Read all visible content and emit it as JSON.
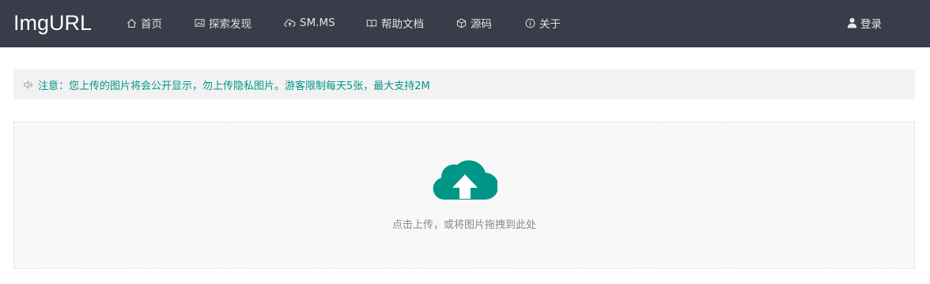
{
  "header": {
    "brand": "ImgURL",
    "nav": [
      {
        "label": "首页",
        "icon": "home-icon"
      },
      {
        "label": "探索发现",
        "icon": "image-icon"
      },
      {
        "label": "SM.MS",
        "icon": "cloud-upload-icon"
      },
      {
        "label": "帮助文档",
        "icon": "book-icon"
      },
      {
        "label": "源码",
        "icon": "box-icon"
      },
      {
        "label": "关于",
        "icon": "info-icon"
      }
    ],
    "login": {
      "label": "登录",
      "icon": "user-icon"
    }
  },
  "notice": {
    "icon": "speaker-icon",
    "text": "注意：您上传的图片将会公开显示，勿上传隐私图片。游客限制每天5张，最大支持2M"
  },
  "upload": {
    "icon": "cloud-upload-icon",
    "hint": "点击上传，或将图片拖拽到此处"
  },
  "colors": {
    "navbar_bg": "#393d49",
    "accent": "#009688",
    "notice_bg": "#f2f2f2",
    "upload_bg": "#f8f8f8"
  }
}
